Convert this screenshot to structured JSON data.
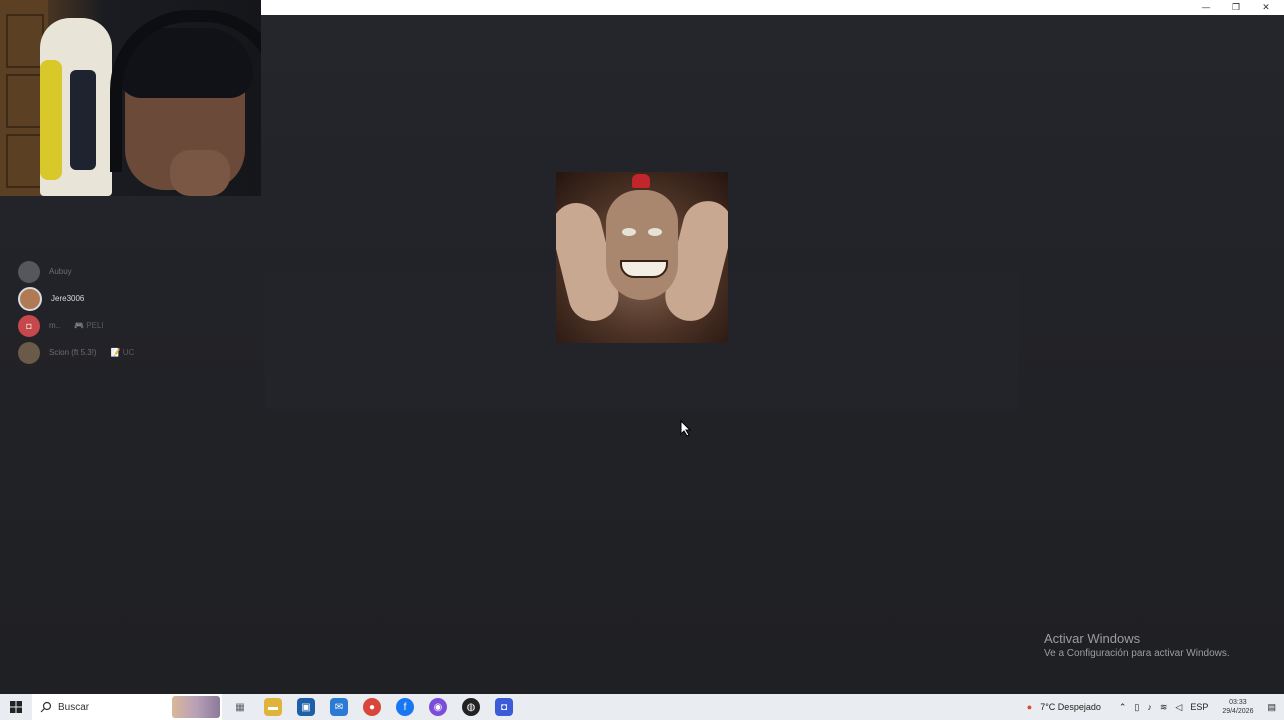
{
  "window": {
    "controls": [
      "minimize",
      "restore",
      "close"
    ]
  },
  "voice_channel": {
    "members": [
      {
        "name": "Aubuy",
        "status": "",
        "active": false,
        "avatar_color": "#55575c"
      },
      {
        "name": "Jere3006",
        "status": "",
        "active": true,
        "avatar_color": "#b07a55"
      },
      {
        "name": "m..",
        "status": "🎮 PELI",
        "active": false,
        "avatar_color": "#c5484c"
      },
      {
        "name": "Scion (ft 5.3!)",
        "status": "📝 UC",
        "active": false,
        "avatar_color": "#6a5a4a"
      }
    ]
  },
  "activation_notice": {
    "title": "Activar Windows",
    "subtitle": "Ve a Configuración para activar Windows."
  },
  "taskbar": {
    "search_label": "Buscar",
    "weather": "7°C  Despejado",
    "language": "ESP",
    "time": "03:33",
    "date": "29/4/2026",
    "pinned": [
      {
        "name": "task-view-icon",
        "color": "#5b5f66",
        "glyph": "▦"
      },
      {
        "name": "file-explorer-icon",
        "color": "#e0b33a",
        "glyph": "▬"
      },
      {
        "name": "store-icon",
        "color": "#1f5fa8",
        "glyph": "▣"
      },
      {
        "name": "mail-icon",
        "color": "#2b7bd4",
        "glyph": "✉"
      },
      {
        "name": "chrome-icon",
        "color": "#d9463b",
        "glyph": "●"
      },
      {
        "name": "facebook-icon",
        "color": "#1877f2",
        "glyph": "f"
      },
      {
        "name": "messenger-icon",
        "color": "#7b4dd8",
        "glyph": "◉"
      },
      {
        "name": "obs-icon",
        "color": "#222222",
        "glyph": "◍"
      },
      {
        "name": "discord-icon",
        "color": "#3b5bd9",
        "glyph": "◘"
      }
    ]
  }
}
